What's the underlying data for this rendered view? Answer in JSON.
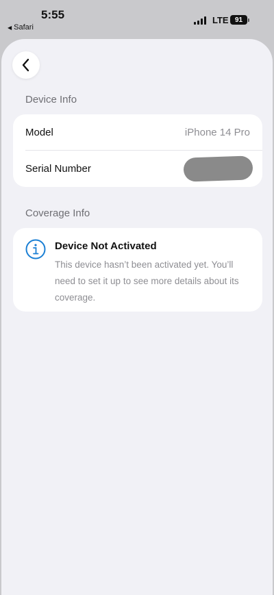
{
  "status_bar": {
    "time": "5:55",
    "back_app": "Safari",
    "network": "LTE",
    "battery": "91"
  },
  "device_info": {
    "section_title": "Device Info",
    "model_label": "Model",
    "model_value": "iPhone 14 Pro",
    "serial_label": "Serial Number"
  },
  "coverage_info": {
    "section_title": "Coverage Info",
    "title": "Device Not Activated",
    "body": "This device hasn’t been activated yet. You’ll need to set it up to see more details about its coverage."
  },
  "icons": {
    "back": "chevron-left-icon",
    "info": "info-circle-icon"
  },
  "colors": {
    "accent": "#1a7fd4",
    "sheet_background": "#f1f1f6",
    "secondary_text": "#8e8e93"
  }
}
